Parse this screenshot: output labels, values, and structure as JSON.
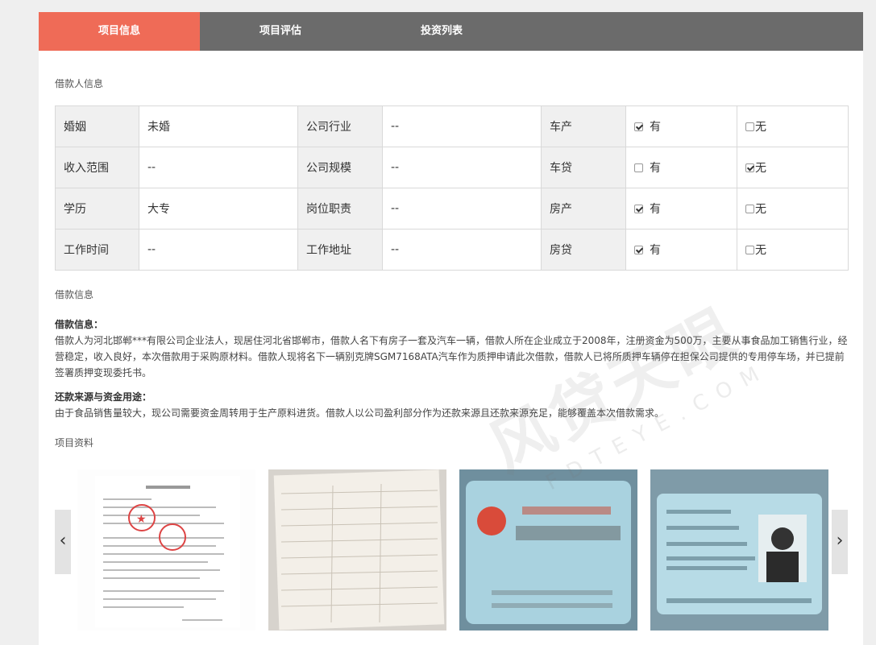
{
  "tabs": [
    {
      "label": "项目信息",
      "active": true
    },
    {
      "label": "项目评估",
      "active": false
    },
    {
      "label": "投资列表",
      "active": false
    }
  ],
  "borrower_section_title": "借款人信息",
  "borrower_table": {
    "rows": [
      {
        "l1": "婚姻",
        "v1": "未婚",
        "l2": "公司行业",
        "v2": "--",
        "l3": "车产",
        "yes": "有",
        "no": "无",
        "checked": "yes"
      },
      {
        "l1": "收入范围",
        "v1": "--",
        "l2": "公司规模",
        "v2": "--",
        "l3": "车贷",
        "yes": "有",
        "no": "无",
        "checked": "no"
      },
      {
        "l1": "学历",
        "v1": "大专",
        "l2": "岗位职责",
        "v2": "--",
        "l3": "房产",
        "yes": "有",
        "no": "无",
        "checked": "yes"
      },
      {
        "l1": "工作时间",
        "v1": "--",
        "l2": "工作地址",
        "v2": "--",
        "l3": "房贷",
        "yes": "有",
        "no": "无",
        "checked": "yes"
      }
    ]
  },
  "loan_section_title": "借款信息",
  "loan_info": {
    "heading": "借款信息：",
    "text": "借款人为河北邯郸***有限公司企业法人，现居住河北省邯郸市，借款人名下有房子一套及汽车一辆，借款人所在企业成立于2008年，注册资金为500万，主要从事食品加工销售行业，经营稳定，收入良好，本次借款用于采购原材料。借款人现将名下一辆别克牌SGM7168ATA汽车作为质押申请此次借款，借款人已将所质押车辆停在担保公司提供的专用停车场，并已提前签署质押变现委托书。"
  },
  "repayment": {
    "heading": "还款来源与资金用途：",
    "text": "由于食品销售量较大，现公司需要资金周转用于生产原料进货。借款人以公司盈利部分作为还款来源且还款来源充足，能够覆盖本次借款需求。"
  },
  "materials_section_title": "项目资料",
  "gallery": {
    "prev": "‹",
    "next": "›"
  },
  "watermark": {
    "main": "风贷天眼",
    "sub": "FDTEYE.COM"
  }
}
